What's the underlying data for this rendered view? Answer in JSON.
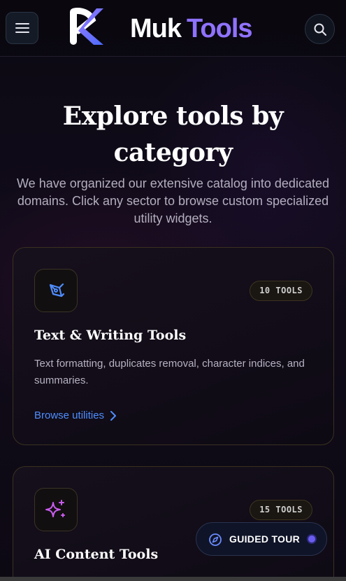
{
  "header": {
    "brand_part1": "Muk",
    "brand_part2": "Tools",
    "menu_icon": "hamburger-menu-icon",
    "search_icon": "search-icon"
  },
  "hero": {
    "title": "Explore tools by category",
    "subtitle": "We have organized our extensive catalog into dedicated domains. Click any sector to browse custom specialized utility widgets."
  },
  "categories": [
    {
      "icon": "pen-nib-icon",
      "badge": "10 TOOLS",
      "title": "Text & Writing Tools",
      "description": "Text formatting, duplicates removal, character indices, and summaries.",
      "link": "Browse utilities"
    },
    {
      "icon": "sparkles-icon",
      "badge": "15 TOOLS",
      "title": "AI Content Tools"
    }
  ],
  "tour": {
    "label": "GUIDED TOUR",
    "icon": "compass-icon"
  },
  "colors": {
    "accent": "#8f72ff",
    "link": "#4f8dff",
    "background": "#0c0912"
  }
}
